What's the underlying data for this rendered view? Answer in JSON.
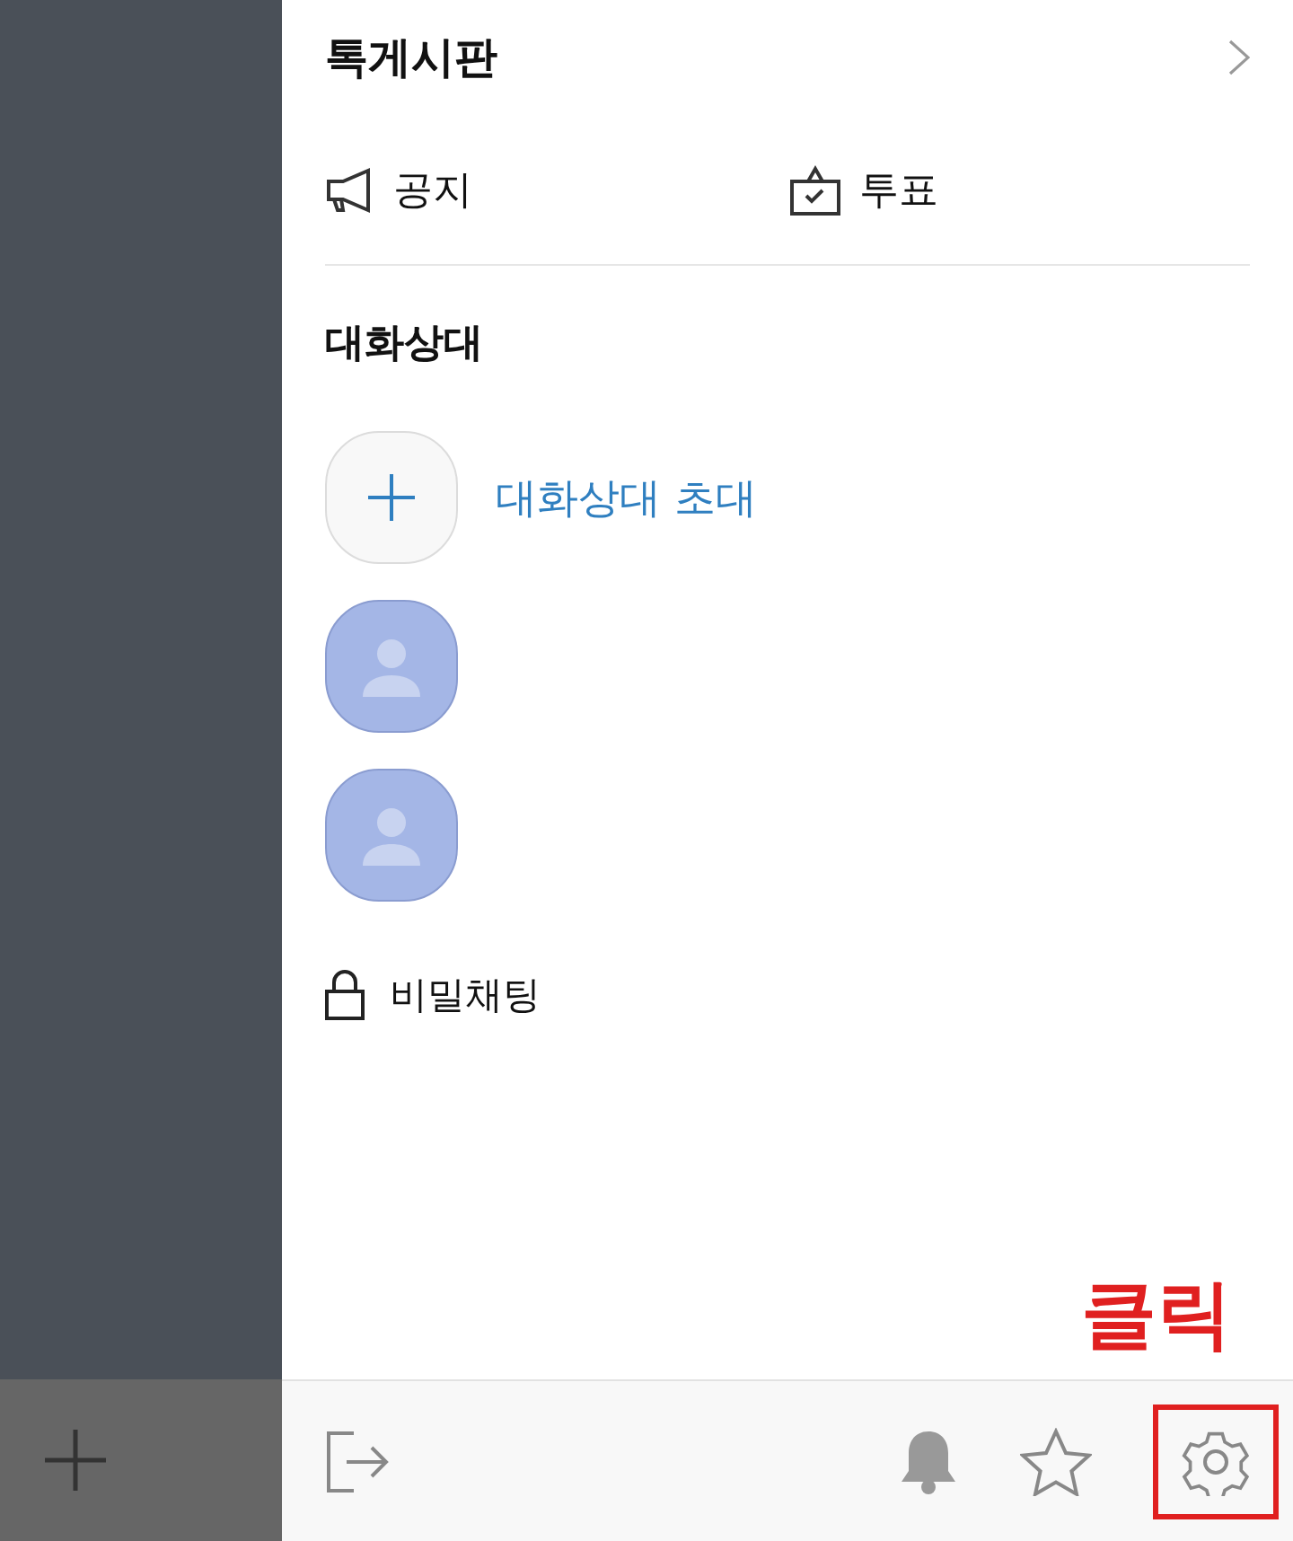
{
  "board": {
    "title": "톡게시판",
    "items": [
      {
        "kind": "notice",
        "label": "공지"
      },
      {
        "kind": "vote",
        "label": "투표"
      }
    ]
  },
  "members": {
    "heading": "대화상대",
    "invite": "대화상대 초대",
    "avatars": [
      {
        "kind": "person"
      },
      {
        "kind": "person"
      }
    ]
  },
  "secret_chat": "비밀채팅",
  "annotation": "클릭",
  "toolbar": [
    {
      "kind": "exit",
      "highlighted": false
    },
    {
      "kind": "bell",
      "highlighted": false
    },
    {
      "kind": "star",
      "highlighted": false
    },
    {
      "kind": "settings",
      "highlighted": true
    }
  ]
}
